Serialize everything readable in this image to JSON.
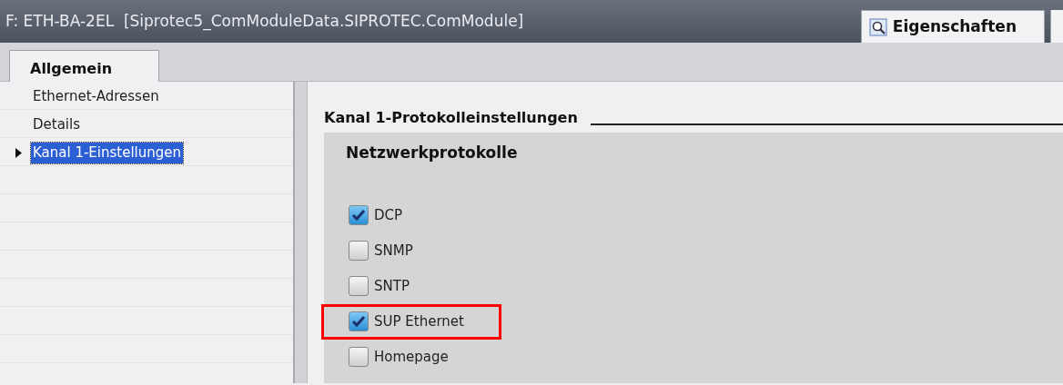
{
  "window": {
    "title": "F: ETH-BA-2EL  [Siprotec5_ComModuleData.SIPROTEC.ComModule]"
  },
  "header_tabs": [
    {
      "label": "Eigenschaften",
      "selected": true
    }
  ],
  "tabs": [
    {
      "label": "Allgemein",
      "selected": true
    }
  ],
  "sidebar": {
    "items": [
      {
        "label": "Ethernet-Adressen",
        "selected": false,
        "expandable": false
      },
      {
        "label": "Details",
        "selected": false,
        "expandable": false
      },
      {
        "label": "Kanal 1-Einstellungen",
        "selected": true,
        "expandable": true
      }
    ]
  },
  "section": {
    "title": "Kanal 1-Protokolleinstellungen",
    "group": {
      "title": "Netzwerkprotokolle",
      "options": [
        {
          "label": "DCP",
          "checked": true,
          "highlighted": false
        },
        {
          "label": "SNMP",
          "checked": false,
          "highlighted": false
        },
        {
          "label": "SNTP",
          "checked": false,
          "highlighted": false
        },
        {
          "label": "SUP Ethernet",
          "checked": true,
          "highlighted": true
        },
        {
          "label": "Homepage",
          "checked": false,
          "highlighted": false
        }
      ]
    }
  }
}
